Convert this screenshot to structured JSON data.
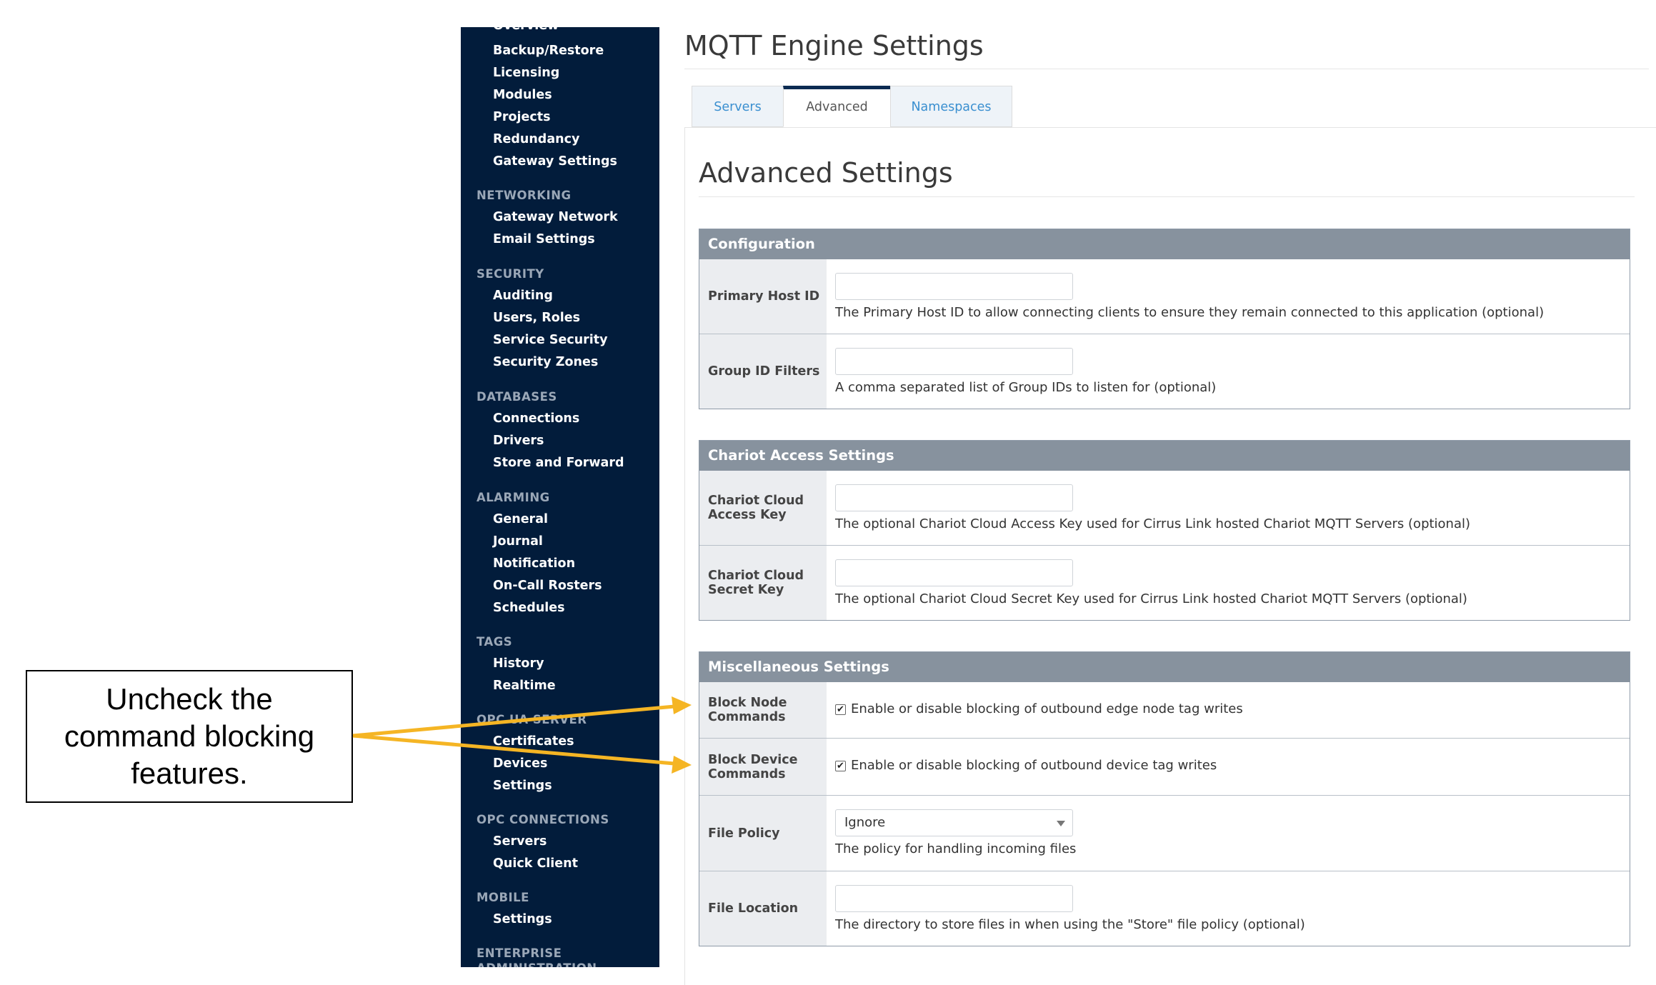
{
  "sidebar": {
    "top_items": [
      "Overview",
      "Backup/Restore",
      "Licensing",
      "Modules",
      "Projects",
      "Redundancy",
      "Gateway Settings"
    ],
    "networking": {
      "title": "NETWORKING",
      "items": [
        "Gateway Network",
        "Email Settings"
      ]
    },
    "security": {
      "title": "SECURITY",
      "items": [
        "Auditing",
        "Users, Roles",
        "Service Security",
        "Security Zones"
      ]
    },
    "databases": {
      "title": "DATABASES",
      "items": [
        "Connections",
        "Drivers",
        "Store and Forward"
      ]
    },
    "alarming": {
      "title": "ALARMING",
      "items": [
        "General",
        "Journal",
        "Notification",
        "On-Call Rosters",
        "Schedules"
      ]
    },
    "tags": {
      "title": "TAGS",
      "items": [
        "History",
        "Realtime"
      ]
    },
    "opcua": {
      "title": "OPC UA SERVER",
      "items": [
        "Certificates",
        "Devices",
        "Settings"
      ]
    },
    "opc_connections": {
      "title": "OPC CONNECTIONS",
      "items": [
        "Servers",
        "Quick Client"
      ]
    },
    "mobile": {
      "title": "MOBILE",
      "items": [
        "Settings"
      ]
    },
    "enterprise": {
      "title": "ENTERPRISE",
      "title2": "ADMINISTRATION"
    }
  },
  "page": {
    "title": "MQTT Engine Settings",
    "tabs": [
      "Servers",
      "Advanced",
      "Namespaces"
    ],
    "section_title": "Advanced Settings"
  },
  "configuration": {
    "header": "Configuration",
    "primary_host_label": "Primary Host ID",
    "primary_host_value": "",
    "primary_host_hint": "The Primary Host ID to allow connecting clients to ensure they remain connected to this application (optional)",
    "group_filters_label": "Group ID Filters",
    "group_filters_value": "",
    "group_filters_hint": "A comma separated list of Group IDs to listen for (optional)"
  },
  "chariot": {
    "header": "Chariot Access Settings",
    "access_key_label_1": "Chariot Cloud",
    "access_key_label_2": "Access Key",
    "access_key_value": "",
    "access_key_hint": "The optional Chariot Cloud Access Key used for Cirrus Link hosted Chariot MQTT Servers (optional)",
    "secret_key_label_1": "Chariot Cloud",
    "secret_key_label_2": "Secret Key",
    "secret_key_value": "",
    "secret_key_hint": "The optional Chariot Cloud Secret Key used for Cirrus Link hosted Chariot MQTT Servers (optional)"
  },
  "misc": {
    "header": "Miscellaneous Settings",
    "block_node_label_1": "Block Node",
    "block_node_label_2": "Commands",
    "block_node_checked": true,
    "block_node_text": "Enable or disable blocking of outbound edge node tag writes",
    "block_device_label_1": "Block Device",
    "block_device_label_2": "Commands",
    "block_device_checked": true,
    "block_device_text": "Enable or disable blocking of outbound device tag writes",
    "file_policy_label": "File Policy",
    "file_policy_value": "Ignore",
    "file_policy_hint": "The policy for handling incoming files",
    "file_location_label": "File Location",
    "file_location_value": "",
    "file_location_hint": "The directory to store files in when using the \"Store\" file policy (optional)"
  },
  "callout": {
    "line1": "Uncheck the",
    "line2": "command blocking",
    "line3": "features."
  },
  "colors": {
    "sidebar_bg": "#021c3b",
    "header_bg": "#87929e",
    "tab_link": "#3a8fd0",
    "arrow": "#f5b524"
  },
  "icons": {
    "checkbox_checked": "checkmark-icon",
    "select_caret": "caret-down-icon"
  }
}
